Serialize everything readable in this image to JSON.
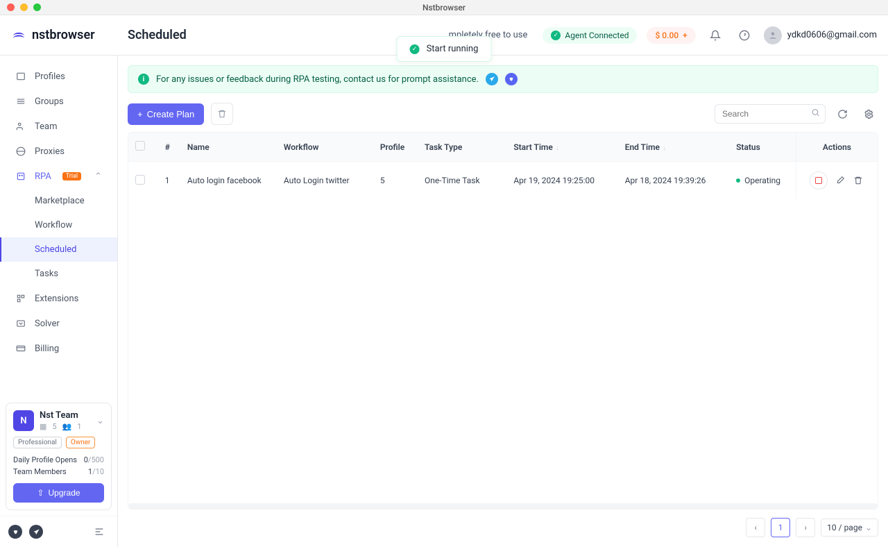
{
  "window": {
    "title": "Nstbrowser"
  },
  "header": {
    "brand": "nstbrowser",
    "page_title": "Scheduled",
    "free_banner": "mpletely free to use",
    "agent_status": "Agent Connected",
    "balance": "$ 0.00",
    "user_email": "ydkd0606@gmail.com"
  },
  "toast": {
    "text": "Start running"
  },
  "sidebar": {
    "items": [
      {
        "label": "Profiles"
      },
      {
        "label": "Groups"
      },
      {
        "label": "Team"
      },
      {
        "label": "Proxies"
      },
      {
        "label": "RPA",
        "trial": "Trial"
      },
      {
        "label": "Marketplace"
      },
      {
        "label": "Workflow"
      },
      {
        "label": "Scheduled"
      },
      {
        "label": "Tasks"
      },
      {
        "label": "Extensions"
      },
      {
        "label": "Solver"
      },
      {
        "label": "Billing"
      }
    ],
    "team_card": {
      "initial": "N",
      "name": "Nst Team",
      "stat1": "5",
      "stat2": "1",
      "badge_pro": "Professional",
      "badge_owner": "Owner",
      "opens_label": "Daily Profile Opens",
      "opens_value": "0",
      "opens_limit": "/500",
      "members_label": "Team Members",
      "members_value": "1",
      "members_limit": "/10",
      "upgrade": "Upgrade"
    }
  },
  "main": {
    "info_banner": "For any issues or feedback during RPA testing, contact us for prompt assistance.",
    "create_plan": "Create Plan",
    "search_placeholder": "Search",
    "columns": {
      "index": "#",
      "name": "Name",
      "workflow": "Workflow",
      "profile": "Profile",
      "task_type": "Task Type",
      "start_time": "Start Time",
      "end_time": "End Time",
      "status": "Status",
      "actions": "Actions"
    },
    "rows": [
      {
        "index": "1",
        "name": "Auto login facebook",
        "workflow": "Auto Login twitter",
        "profile": "5",
        "task_type": "One-Time Task",
        "start_time": "Apr 19, 2024 19:25:00",
        "end_time": "Apr 18, 2024 19:39:26",
        "status": "Operating"
      }
    ],
    "pagination": {
      "page": "1",
      "size": "10 / page"
    }
  }
}
